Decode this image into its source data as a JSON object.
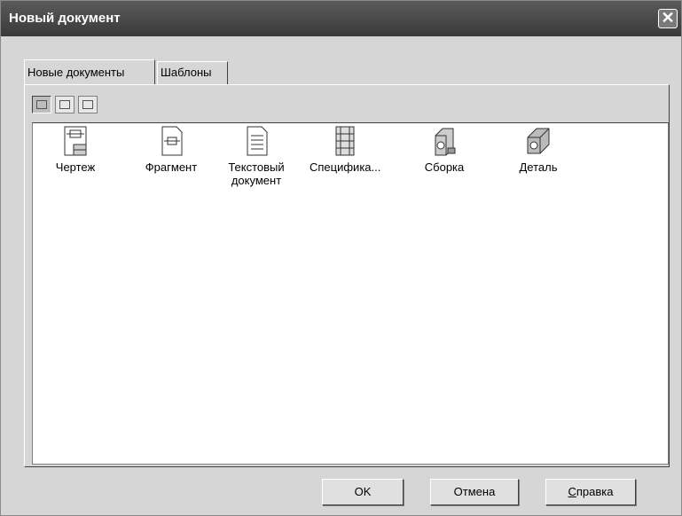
{
  "window": {
    "title": "Новый документ",
    "close_label": "✕"
  },
  "tabs": [
    {
      "label": "Новые документы",
      "active": true
    },
    {
      "label": "Шаблоны",
      "active": false
    }
  ],
  "view_buttons": [
    {
      "icon": "large-icons-view-icon",
      "active": true
    },
    {
      "icon": "small-icons-view-icon",
      "active": false
    },
    {
      "icon": "details-view-icon",
      "active": false
    }
  ],
  "documents": [
    {
      "label": "Чертеж",
      "icon": "drawing-icon"
    },
    {
      "label": "Фрагмент",
      "icon": "fragment-icon"
    },
    {
      "label": "Текстовый документ",
      "icon": "text-document-icon"
    },
    {
      "label": "Специфика...",
      "icon": "specification-icon"
    },
    {
      "label": "Сборка",
      "icon": "assembly-icon"
    },
    {
      "label": "Деталь",
      "icon": "part-icon"
    }
  ],
  "buttons": {
    "ok": "OK",
    "cancel": "Отмена",
    "help_first": "С",
    "help_rest": "правка"
  }
}
